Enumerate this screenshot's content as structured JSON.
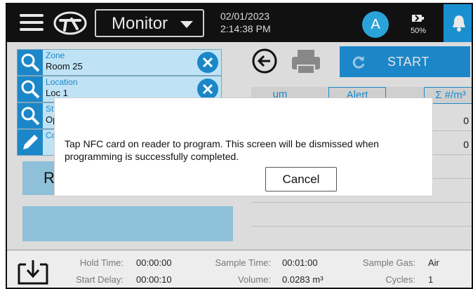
{
  "header": {
    "view_selector": "Monitor",
    "date": "02/01/2023",
    "time": "2:14:38 PM",
    "user_initial": "A",
    "battery_percent": "50%"
  },
  "fields": [
    {
      "label": "Zone",
      "value": "Room 25"
    },
    {
      "label": "Location",
      "value": "Loc 1"
    },
    {
      "label": "St",
      "value": "Op"
    },
    {
      "label": "Co",
      "value": ""
    }
  ],
  "left": {
    "recent_button": "Re"
  },
  "right": {
    "start_button": "START",
    "columns": [
      "um",
      "Alert",
      "Σ #/m³"
    ],
    "row_values": [
      "0",
      "0"
    ]
  },
  "footer": {
    "hold_time_label": "Hold Time:",
    "hold_time": "00:00:00",
    "start_delay_label": "Start Delay:",
    "start_delay": "00:00:10",
    "sample_time_label": "Sample Time:",
    "sample_time": "00:01:00",
    "volume_label": "Volume:",
    "volume": "0.0283 m³",
    "sample_gas_label": "Sample Gas:",
    "sample_gas": "Air",
    "cycles_label": "Cycles:",
    "cycles": "1"
  },
  "modal": {
    "message": "Tap NFC card on reader to program. This screen will be dismissed when programming is successfully completed.",
    "cancel_label": "Cancel"
  },
  "colors": {
    "accent": "#1b87c9",
    "header_bg": "#111111",
    "field_bg": "#bfe3f5"
  }
}
